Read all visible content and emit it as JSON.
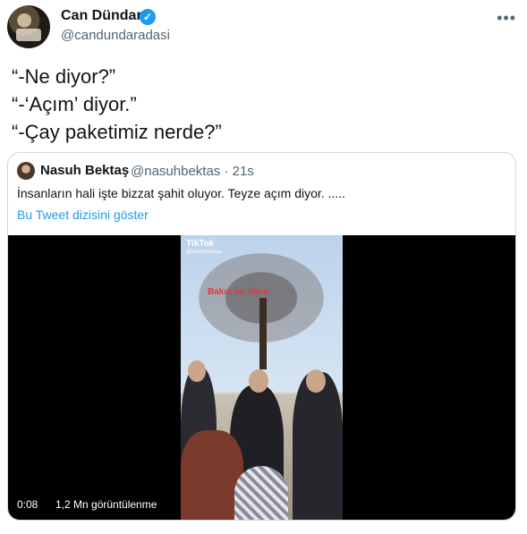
{
  "author": {
    "display_name": "Can Dündar",
    "handle": "@candundaradasi",
    "verified_icon": "verified-badge-icon",
    "accent": "#1d9bf0"
  },
  "more_icon": "more-horizontal-icon",
  "tweet": {
    "lines": [
      "“-Ne diyor?”",
      "“-‘Açım’ diyor.”",
      "“-Çay paketimiz nerde?”"
    ]
  },
  "quote": {
    "display_name": "Nasuh Bektaş",
    "meta": "@nasuhbektas · 21s",
    "text": "İnsanların hali işte bizzat şahit oluyor. Teyze açım diyor. .....",
    "thread_link": "Bu Tweet dizisini göster",
    "video": {
      "tiktok_label": "TikTok",
      "tiktok_handle": "@nasuhbektas",
      "overlay_caption": "Bakın ne diyor",
      "elapsed": "0:08",
      "views": "1,2 Mn görüntülenme"
    }
  }
}
